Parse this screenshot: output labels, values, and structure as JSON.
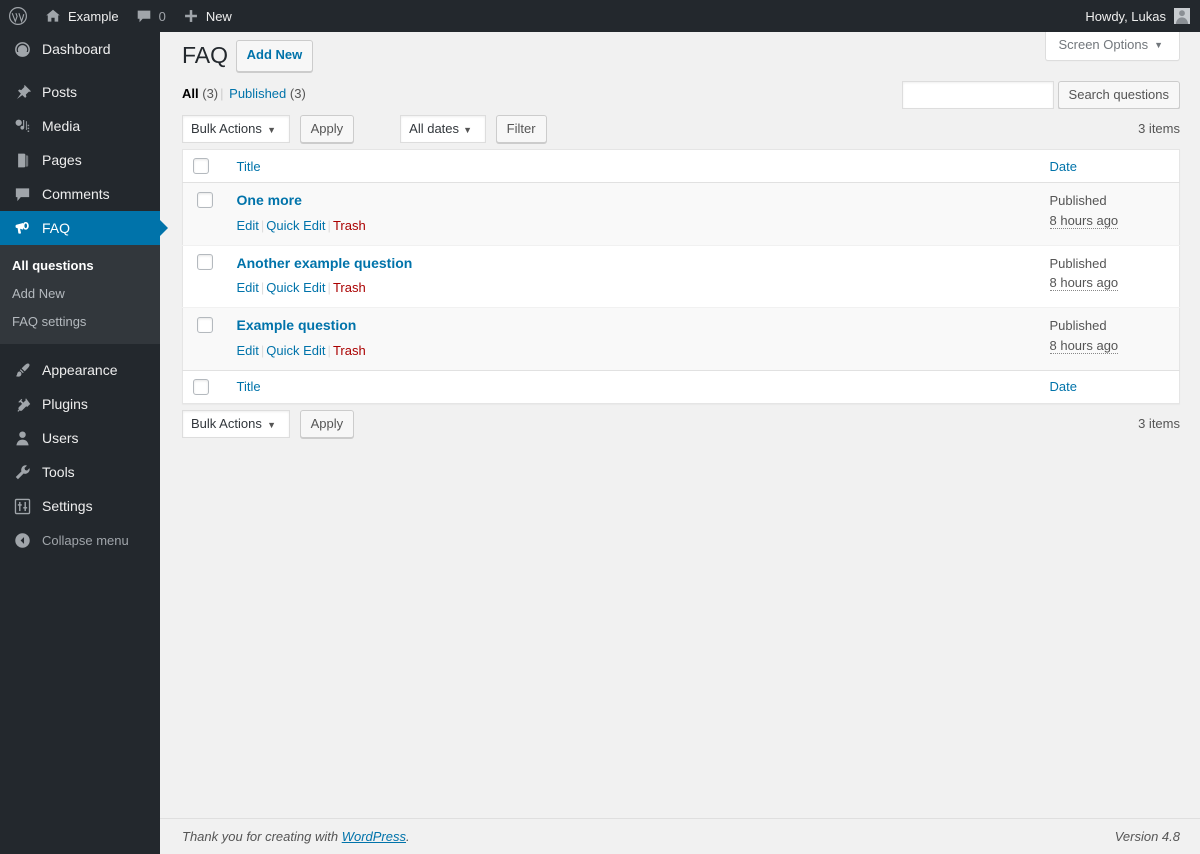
{
  "adminbar": {
    "logo_icon": "wordpress-logo-icon",
    "site": {
      "icon": "home-icon",
      "label": "Example"
    },
    "comments": {
      "icon": "comment-bubble-icon",
      "count": "0"
    },
    "new": {
      "icon": "plus-icon",
      "label": "New"
    },
    "account": {
      "greeting": "Howdy, Lukas",
      "avatar_icon": "avatar-icon"
    }
  },
  "sidebar": {
    "items": [
      {
        "label": "Dashboard",
        "icon": "dashboard-icon"
      },
      {
        "label": "Posts",
        "icon": "pin-icon"
      },
      {
        "label": "Media",
        "icon": "media-icon"
      },
      {
        "label": "Pages",
        "icon": "pages-icon"
      },
      {
        "label": "Comments",
        "icon": "comment-icon"
      },
      {
        "label": "FAQ",
        "icon": "megaphone-icon"
      },
      {
        "label": "Appearance",
        "icon": "paintbrush-icon"
      },
      {
        "label": "Plugins",
        "icon": "plug-icon"
      },
      {
        "label": "Users",
        "icon": "user-icon"
      },
      {
        "label": "Tools",
        "icon": "wrench-icon"
      },
      {
        "label": "Settings",
        "icon": "sliders-icon"
      }
    ],
    "submenu": [
      {
        "label": "All questions",
        "current": true
      },
      {
        "label": "Add New",
        "current": false
      },
      {
        "label": "FAQ settings",
        "current": false
      }
    ],
    "collapse": {
      "label": "Collapse menu",
      "icon": "collapse-arrow-icon"
    },
    "highlight_color": "#0073aa"
  },
  "screen_meta": {
    "toggle_label": "Screen Options",
    "caret": "▼"
  },
  "page": {
    "title": "FAQ",
    "add_new_label": "Add New"
  },
  "views": [
    {
      "label": "All",
      "count": "(3)",
      "current": true
    },
    {
      "label": "Published",
      "count": "(3)",
      "current": false
    }
  ],
  "search": {
    "placeholder": "",
    "value": "",
    "button_label": "Search questions"
  },
  "tablenav_top": {
    "bulk_actions": {
      "value": "Bulk Actions",
      "caret": "▼"
    },
    "apply_label": "Apply",
    "dates": {
      "value": "All dates",
      "caret": "▼"
    },
    "filter_label": "Filter",
    "count_label": "3 items"
  },
  "tablenav_bottom": {
    "bulk_actions": {
      "value": "Bulk Actions",
      "caret": "▼"
    },
    "apply_label": "Apply",
    "count_label": "3 items"
  },
  "table": {
    "columns": {
      "title": "Title",
      "date": "Date"
    },
    "rows": [
      {
        "title": "One more",
        "actions": {
          "edit": "Edit",
          "quick_edit": "Quick Edit",
          "trash": "Trash"
        },
        "status": "Published",
        "date": "8 hours ago"
      },
      {
        "title": "Another example question",
        "actions": {
          "edit": "Edit",
          "quick_edit": "Quick Edit",
          "trash": "Trash"
        },
        "status": "Published",
        "date": "8 hours ago"
      },
      {
        "title": "Example question",
        "actions": {
          "edit": "Edit",
          "quick_edit": "Quick Edit",
          "trash": "Trash"
        },
        "status": "Published",
        "date": "8 hours ago"
      }
    ]
  },
  "footer": {
    "thanks_prefix": "Thank you for creating with ",
    "wordpress_link": "WordPress",
    "thanks_suffix": ".",
    "version": "Version 4.8"
  }
}
